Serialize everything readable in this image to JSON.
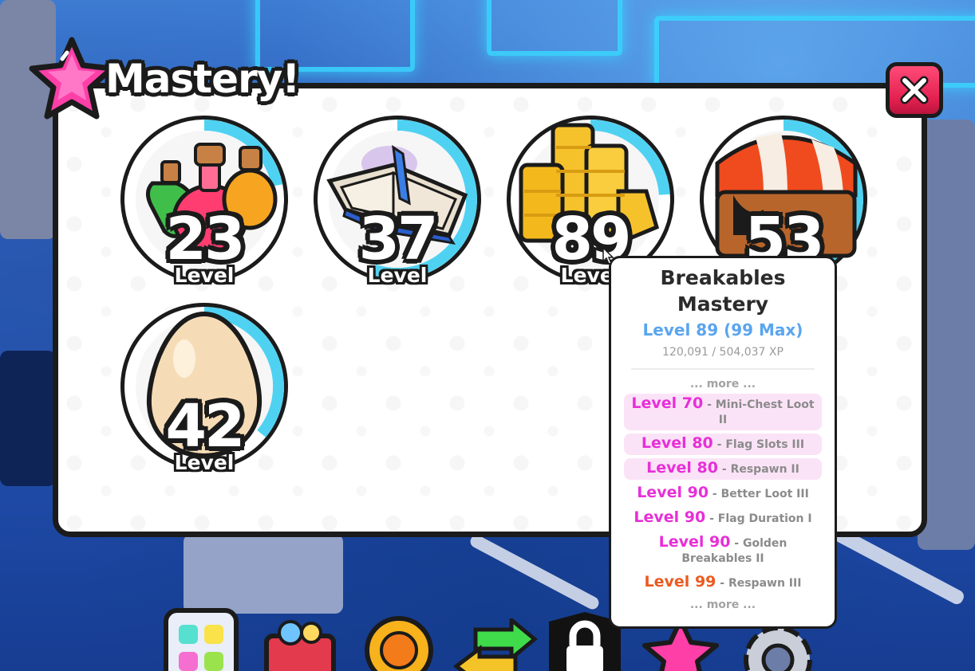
{
  "title": "Mastery!",
  "close_icon": "x-icon",
  "masteries": [
    {
      "name": "potions-mastery",
      "icon": "potions-icon",
      "level": "23",
      "label": "Level",
      "progress": 0.22
    },
    {
      "name": "enchants-mastery",
      "icon": "spellbook-icon",
      "level": "37",
      "label": "Level",
      "progress": 0.55
    },
    {
      "name": "breakables-mastery",
      "icon": "coins-icon",
      "level": "89",
      "label": "Level",
      "progress": 0.24
    },
    {
      "name": "merchants-mastery",
      "icon": "merchant-stand-icon",
      "level": "53",
      "label": "Level",
      "progress": 0.4
    },
    {
      "name": "eggs-mastery",
      "icon": "egg-icon",
      "level": "42",
      "label": "Level",
      "progress": 0.36
    }
  ],
  "tooltip": {
    "title_line1": "Breakables",
    "title_line2": "Mastery",
    "level_text": "Level 89 (99 Max)",
    "xp_text": "120,091 / 504,037 XP",
    "more_top": "... more ...",
    "more_bottom": "... more ...",
    "rewards": [
      {
        "level": "Level 70",
        "sep": " - ",
        "reward": "Mini-Chest Loot II",
        "highlight": true,
        "max": false
      },
      {
        "level": "Level 80",
        "sep": " - ",
        "reward": "Flag Slots III",
        "highlight": true,
        "max": false
      },
      {
        "level": "Level 80",
        "sep": " - ",
        "reward": "Respawn II",
        "highlight": true,
        "max": false
      },
      {
        "level": "Level 90",
        "sep": " - ",
        "reward": "Better Loot III",
        "highlight": false,
        "max": false
      },
      {
        "level": "Level 90",
        "sep": " - ",
        "reward": "Flag Duration I",
        "highlight": false,
        "max": false
      },
      {
        "level": "Level 90",
        "sep": " - ",
        "reward": "Golden Breakables II",
        "highlight": false,
        "max": false
      },
      {
        "level": "Level 99",
        "sep": " - ",
        "reward": "Respawn III",
        "highlight": false,
        "max": true
      }
    ]
  },
  "colors": {
    "level_pink": "#e82fd8",
    "level_max": "#ec5a1f",
    "level_blue": "#5aa5ef",
    "progress_ring": "#4fd2f2",
    "close_red": "#e3204f"
  },
  "hotbar": [
    {
      "name": "pets-inventory-button",
      "icon": "cat-grid-icon"
    },
    {
      "name": "shop-basket-button",
      "icon": "basket-icon"
    },
    {
      "name": "rewards-button",
      "icon": "gold-badge-icon"
    },
    {
      "name": "trade-button",
      "icon": "arrows-icon"
    },
    {
      "name": "locked-button",
      "icon": "lock-icon"
    },
    {
      "name": "mastery-button",
      "icon": "star-icon"
    },
    {
      "name": "settings-button",
      "icon": "gear-icon"
    }
  ]
}
